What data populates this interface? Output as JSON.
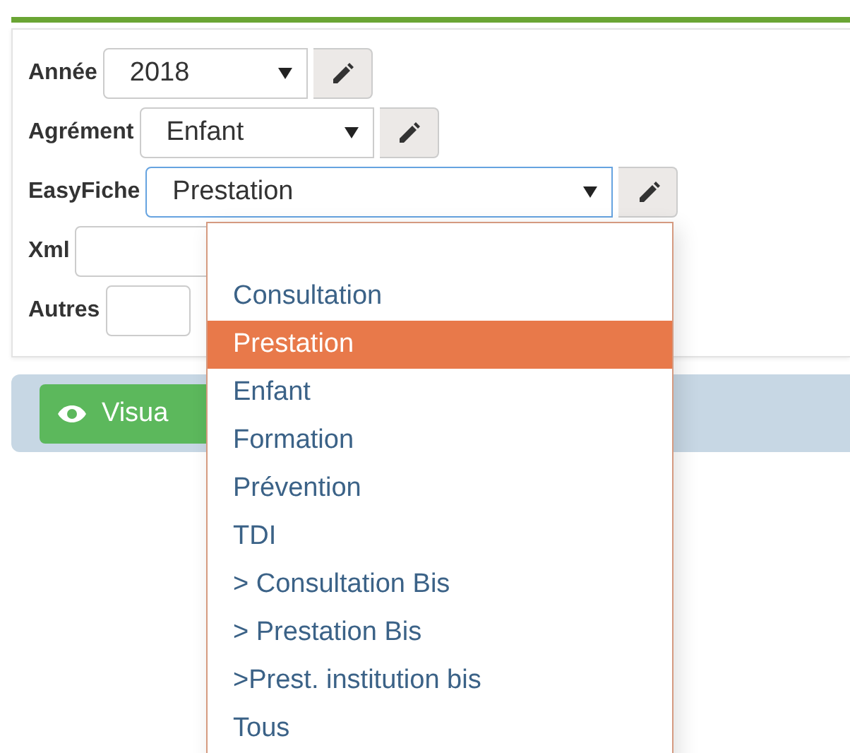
{
  "fields": [
    {
      "kind": "select",
      "label": "Année",
      "value": "2018",
      "open": false
    },
    {
      "kind": "select",
      "label": "Agrément",
      "value": "Enfant",
      "open": false
    },
    {
      "kind": "select",
      "label": "EasyFiche",
      "value": "Prestation",
      "open": true
    },
    {
      "kind": "text",
      "label": "Xml"
    },
    {
      "kind": "text",
      "label": "Autres"
    }
  ],
  "dropdown": {
    "options": [
      {
        "label": "Consultation",
        "selected": false
      },
      {
        "label": "Prestation",
        "selected": true
      },
      {
        "label": "Enfant",
        "selected": false
      },
      {
        "label": "Formation",
        "selected": false
      },
      {
        "label": "Prévention",
        "selected": false
      },
      {
        "label": "TDI",
        "selected": false
      },
      {
        "label": "> Consultation Bis",
        "selected": false
      },
      {
        "label": "> Prestation Bis",
        "selected": false
      },
      {
        "label": ">Prest. institution bis",
        "selected": false
      },
      {
        "label": "Tous",
        "selected": false
      }
    ]
  },
  "action_button": {
    "label": "Visua"
  }
}
